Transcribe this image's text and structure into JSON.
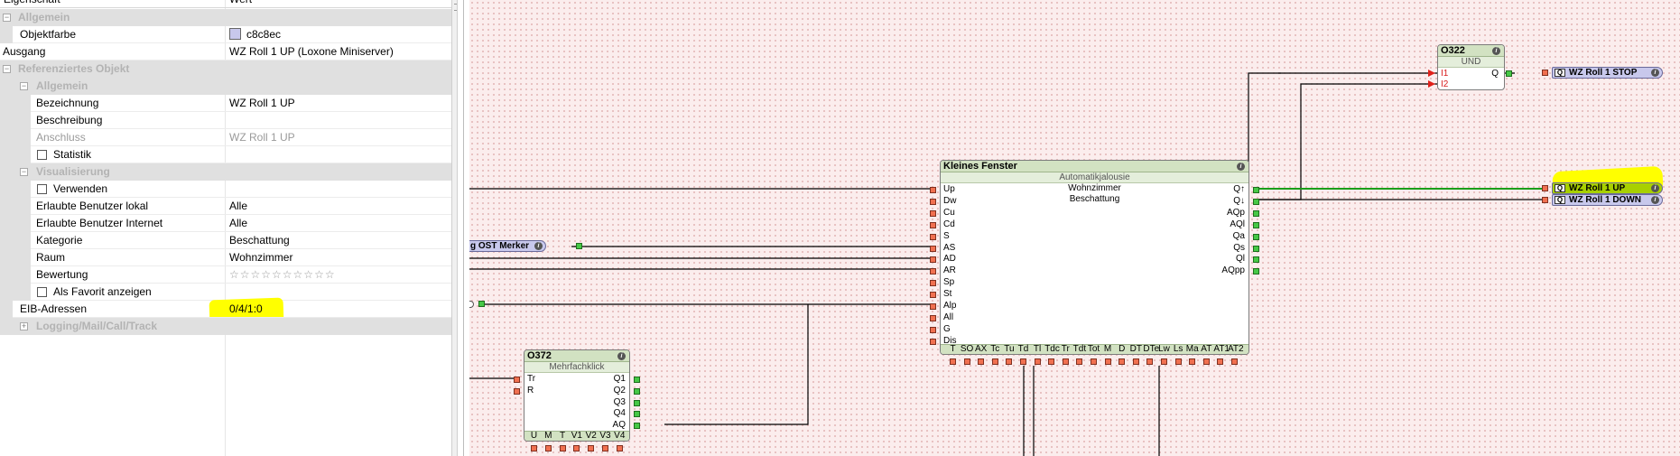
{
  "properties": {
    "header": {
      "name": "Eigenschaft",
      "value": "Wert"
    },
    "rows": {
      "allgemein": "Allgemein",
      "objektfarbe_label": "Objektfarbe",
      "objektfarbe_value": "c8c8ec",
      "ausgang_label": "Ausgang",
      "ausgang_value": "WZ Roll 1 UP (Loxone Miniserver)",
      "ref_obj": "Referenziertes Objekt",
      "allgemein2": "Allgemein",
      "bezeichnung_label": "Bezeichnung",
      "bezeichnung_value": "WZ Roll 1 UP",
      "beschreibung_label": "Beschreibung",
      "beschreibung_value": "",
      "anschluss_label": "Anschluss",
      "anschluss_value": "WZ Roll 1 UP",
      "statistik_label": "Statistik",
      "visualisierung": "Visualisierung",
      "verwenden_label": "Verwenden",
      "erlaubte_lokal_label": "Erlaubte Benutzer lokal",
      "erlaubte_lokal_value": "Alle",
      "erlaubte_internet_label": "Erlaubte Benutzer Internet",
      "erlaubte_internet_value": "Alle",
      "kategorie_label": "Kategorie",
      "kategorie_value": "Beschattung",
      "raum_label": "Raum",
      "raum_value": "Wohnzimmer",
      "bewertung_label": "Bewertung",
      "bewertung_stars": "☆☆☆☆☆☆☆☆☆☆",
      "favorit_label": "Als Favorit anzeigen",
      "eib_label": "EIB-Adressen",
      "eib_value": "0/4/1:0",
      "logging": "Logging/Mail/Call/Track"
    },
    "swatch_color": "#c8c8ec",
    "highlight_color": "#ffff00"
  },
  "canvas": {
    "merker_tag": "g OST Merker",
    "o322": {
      "title": "O322",
      "subtitle": "UND",
      "in1": "I1",
      "in2": "I2",
      "out": "Q"
    },
    "kleines_fenster": {
      "title": "Kleines Fenster",
      "subtitle": "Automatikjalousie",
      "line1": "Wohnzimmer",
      "line2": "Beschattung",
      "inputs": [
        "Up",
        "Dw",
        "Cu",
        "Cd",
        "S",
        "AS",
        "AD",
        "AR",
        "Sp",
        "St",
        "Alp",
        "All",
        "G",
        "Dis"
      ],
      "outputs": [
        "Q↑",
        "Q↓",
        "AQp",
        "AQl",
        "Qa",
        "Qs",
        "Ql",
        "AQpp"
      ],
      "bottom": [
        "T",
        "SO",
        "AX",
        "Tc",
        "Tu",
        "Td",
        "Tl",
        "Tdc",
        "Tr",
        "Tdt",
        "Tot",
        "M",
        "D",
        "DT",
        "DTe",
        "Lw",
        "Ls",
        "Ma",
        "AT",
        "AT1",
        "AT2"
      ]
    },
    "o372": {
      "title": "O372",
      "subtitle": "Mehrfachklick",
      "inputs": [
        "Tr",
        "R"
      ],
      "outputs": [
        "Q1",
        "Q2",
        "Q3",
        "Q4",
        "AQ"
      ],
      "bottom": [
        "U",
        "M",
        "T",
        "V1",
        "V2",
        "V3",
        "V4"
      ]
    },
    "tags": {
      "stop": "WZ Roll 1 STOP",
      "up": "WZ Roll 1 UP",
      "down": "WZ Roll 1 DOWN",
      "q": "Q"
    },
    "info_glyph": "i"
  }
}
